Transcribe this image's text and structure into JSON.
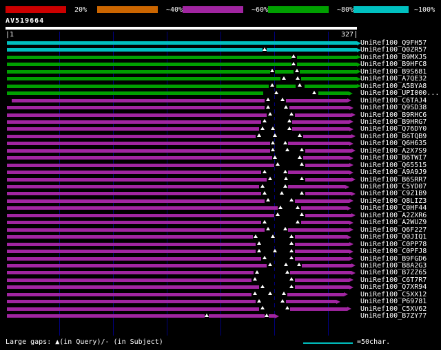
{
  "title": "AV519664",
  "ruler": {
    "start_tick": "|1",
    "end": "327"
  },
  "footer": {
    "gaps_note": "Large gaps: ▲(in Query)/- (in Subject)",
    "scale_label": "=50char."
  },
  "colors": {
    "background": "#000000",
    "grid": "#000080",
    "query_bar": "#ffffff",
    "mark": "#ffffff"
  },
  "legend": {
    "items": [
      {
        "label": "20%",
        "color": "#cc0000"
      },
      {
        "label": "~40%",
        "color": "#cc6600"
      },
      {
        "label": "~60%",
        "color": "#a125a1"
      },
      {
        "label": "~80%",
        "color": "#00a000"
      },
      {
        "label": "~100%",
        "color": "#00c0c0"
      }
    ]
  },
  "chart_data": {
    "type": "alignment-overview",
    "query": {
      "name": "AV519664",
      "length": 327
    },
    "grid_interval_chars": 50,
    "tiers": {
      "cyan": "#00c0c0",
      "green": "#00a000",
      "purple": "#a125a1"
    },
    "hits": [
      {
        "name": "UniRef100_Q9FH57",
        "tier": "cyan",
        "start": 1,
        "end": 327,
        "gaps": [],
        "marks": []
      },
      {
        "name": "UniRef100_Q0ZR57",
        "tier": "cyan",
        "start": 1,
        "end": 327,
        "gaps": [
          [
            239,
            243
          ]
        ],
        "marks": [
          241
        ]
      },
      {
        "name": "UniRef100_B9MXJ5",
        "tier": "green",
        "start": 1,
        "end": 327,
        "gaps": [
          [
            266,
            271
          ]
        ],
        "marks": [
          268
        ]
      },
      {
        "name": "UniRef100_B9HFC8",
        "tier": "green",
        "start": 1,
        "end": 327,
        "gaps": [
          [
            266,
            271
          ]
        ],
        "marks": [
          268
        ]
      },
      {
        "name": "UniRef100_B9S681",
        "tier": "green",
        "start": 1,
        "end": 327,
        "gaps": [
          [
            246,
            251
          ],
          [
            268,
            274
          ]
        ],
        "marks": [
          248,
          271
        ]
      },
      {
        "name": "UniRef100_A7QE32",
        "tier": "green",
        "start": 1,
        "end": 327,
        "gaps": [
          [
            256,
            275
          ]
        ],
        "marks": [
          259,
          272
        ]
      },
      {
        "name": "UniRef100_A5BYA8",
        "tier": "green",
        "start": 1,
        "end": 327,
        "gaps": [
          [
            245,
            252
          ],
          [
            270,
            278
          ]
        ],
        "marks": [
          248,
          274
        ]
      },
      {
        "name": "UniRef100_UPI000...",
        "tier": "green",
        "start": 1,
        "end": 319,
        "gaps": [
          [
            240,
            291
          ]
        ],
        "marks": [
          252,
          287
        ]
      },
      {
        "name": "UniRef100_C6TAJ4",
        "tier": "purple",
        "start": 6,
        "end": 318,
        "gaps": [
          [
            241,
            261
          ]
        ],
        "marks": [
          244,
          258
        ]
      },
      {
        "name": "UniRef100_Q9SD38",
        "tier": "purple",
        "start": 1,
        "end": 320,
        "gaps": [
          [
            241,
            264
          ]
        ],
        "marks": [
          244,
          261
        ]
      },
      {
        "name": "UniRef100_B9RHC6",
        "tier": "purple",
        "start": 1,
        "end": 322,
        "gaps": [
          [
            243,
            269
          ]
        ],
        "marks": [
          246,
          266
        ]
      },
      {
        "name": "UniRef100_B9HRG7",
        "tier": "purple",
        "start": 1,
        "end": 320,
        "gaps": [
          [
            238,
            267
          ]
        ],
        "marks": [
          241,
          264
        ]
      },
      {
        "name": "UniRef100_Q76DY0",
        "tier": "purple",
        "start": 1,
        "end": 320,
        "gaps": [
          [
            236,
            267
          ]
        ],
        "marks": [
          239,
          249,
          264
        ]
      },
      {
        "name": "UniRef100_B6TQB9",
        "tier": "purple",
        "start": 1,
        "end": 322,
        "gaps": [
          [
            233,
            277
          ]
        ],
        "marks": [
          236,
          251,
          274
        ]
      },
      {
        "name": "UniRef100_Q6H635",
        "tier": "purple",
        "start": 1,
        "end": 320,
        "gaps": [
          [
            246,
            263
          ]
        ],
        "marks": [
          249,
          260
        ]
      },
      {
        "name": "UniRef100_A2X7S9",
        "tier": "purple",
        "start": 1,
        "end": 322,
        "gaps": [
          [
            246,
            279
          ]
        ],
        "marks": [
          249,
          262,
          276
        ]
      },
      {
        "name": "UniRef100_B6TWI7",
        "tier": "purple",
        "start": 1,
        "end": 320,
        "gaps": [
          [
            248,
            277
          ]
        ],
        "marks": [
          251,
          274
        ]
      },
      {
        "name": "UniRef100_Q65515",
        "tier": "purple",
        "start": 1,
        "end": 320,
        "gaps": [
          [
            250,
            279
          ]
        ],
        "marks": [
          253,
          276
        ]
      },
      {
        "name": "UniRef100_A9A9J9",
        "tier": "purple",
        "start": 1,
        "end": 320,
        "gaps": [
          [
            238,
            263
          ]
        ],
        "marks": [
          241,
          260
        ]
      },
      {
        "name": "UniRef100_B6SRR7",
        "tier": "purple",
        "start": 1,
        "end": 322,
        "gaps": [
          [
            243,
            279
          ]
        ],
        "marks": [
          246,
          261,
          276
        ]
      },
      {
        "name": "UniRef100_C5YD07",
        "tier": "purple",
        "start": 1,
        "end": 316,
        "gaps": [
          [
            236,
            263
          ]
        ],
        "marks": [
          239,
          260
        ]
      },
      {
        "name": "UniRef100_C9Z1B9",
        "tier": "purple",
        "start": 1,
        "end": 322,
        "gaps": [
          [
            238,
            279
          ]
        ],
        "marks": [
          241,
          257,
          276
        ]
      },
      {
        "name": "UniRef100_Q8LIZ3",
        "tier": "purple",
        "start": 1,
        "end": 320,
        "gaps": [
          [
            241,
            269
          ]
        ],
        "marks": [
          244,
          266
        ]
      },
      {
        "name": "UniRef100_C0HF44",
        "tier": "purple",
        "start": 1,
        "end": 318,
        "gaps": [
          [
            253,
            275
          ]
        ],
        "marks": [
          256,
          272
        ]
      },
      {
        "name": "UniRef100_A2ZXR6",
        "tier": "purple",
        "start": 1,
        "end": 322,
        "gaps": [
          [
            250,
            279
          ]
        ],
        "marks": [
          253,
          276
        ]
      },
      {
        "name": "UniRef100_A2WUZ9",
        "tier": "purple",
        "start": 1,
        "end": 320,
        "gaps": [
          [
            238,
            275
          ]
        ],
        "marks": [
          241,
          272
        ]
      },
      {
        "name": "UniRef100_Q6F227",
        "tier": "purple",
        "start": 1,
        "end": 320,
        "gaps": [
          [
            241,
            263
          ]
        ],
        "marks": [
          244,
          260
        ]
      },
      {
        "name": "UniRef100_Q0JIQ1",
        "tier": "purple",
        "start": 1,
        "end": 318,
        "gaps": [
          [
            230,
            269
          ]
        ],
        "marks": [
          233,
          249,
          266
        ]
      },
      {
        "name": "UniRef100_C0PP78",
        "tier": "purple",
        "start": 1,
        "end": 320,
        "gaps": [
          [
            233,
            269
          ]
        ],
        "marks": [
          236,
          266
        ]
      },
      {
        "name": "UniRef100_C0PFJ8",
        "tier": "purple",
        "start": 1,
        "end": 320,
        "gaps": [
          [
            233,
            269
          ]
        ],
        "marks": [
          236,
          251,
          266
        ]
      },
      {
        "name": "UniRef100_B9FGD6",
        "tier": "purple",
        "start": 1,
        "end": 320,
        "gaps": [
          [
            238,
            269
          ]
        ],
        "marks": [
          241,
          266
        ]
      },
      {
        "name": "UniRef100_B8A2G3",
        "tier": "purple",
        "start": 1,
        "end": 322,
        "gaps": [
          [
            243,
            276
          ]
        ],
        "marks": [
          246,
          261,
          273
        ]
      },
      {
        "name": "UniRef100_B7ZZ65",
        "tier": "purple",
        "start": 1,
        "end": 322,
        "gaps": [
          [
            231,
            265
          ]
        ],
        "marks": [
          234,
          262
        ]
      },
      {
        "name": "UniRef100_C6T7R7",
        "tier": "purple",
        "start": 1,
        "end": 320,
        "gaps": [
          [
            229,
            269
          ]
        ],
        "marks": [
          232,
          266
        ]
      },
      {
        "name": "UniRef100_Q7XR94",
        "tier": "purple",
        "start": 1,
        "end": 320,
        "gaps": [
          [
            236,
            269
          ]
        ],
        "marks": [
          239,
          266
        ]
      },
      {
        "name": "UniRef100_C5XX12",
        "tier": "purple",
        "start": 1,
        "end": 315,
        "gaps": [
          [
            229,
            262
          ]
        ],
        "marks": [
          232,
          246,
          259
        ]
      },
      {
        "name": "UniRef100_P69781",
        "tier": "purple",
        "start": 1,
        "end": 308,
        "gaps": [
          [
            233,
            261
          ]
        ],
        "marks": [
          236,
          258
        ]
      },
      {
        "name": "UniRef100_C5XV62",
        "tier": "purple",
        "start": 1,
        "end": 318,
        "gaps": [
          [
            236,
            265
          ]
        ],
        "marks": [
          239,
          262
        ]
      },
      {
        "name": "UniRef100_B7ZY77",
        "tier": "purple",
        "start": 1,
        "end": 251,
        "gaps": [
          [
            185,
            189
          ],
          [
            241,
            245
          ]
        ],
        "marks": [
          187,
          243
        ]
      }
    ]
  }
}
